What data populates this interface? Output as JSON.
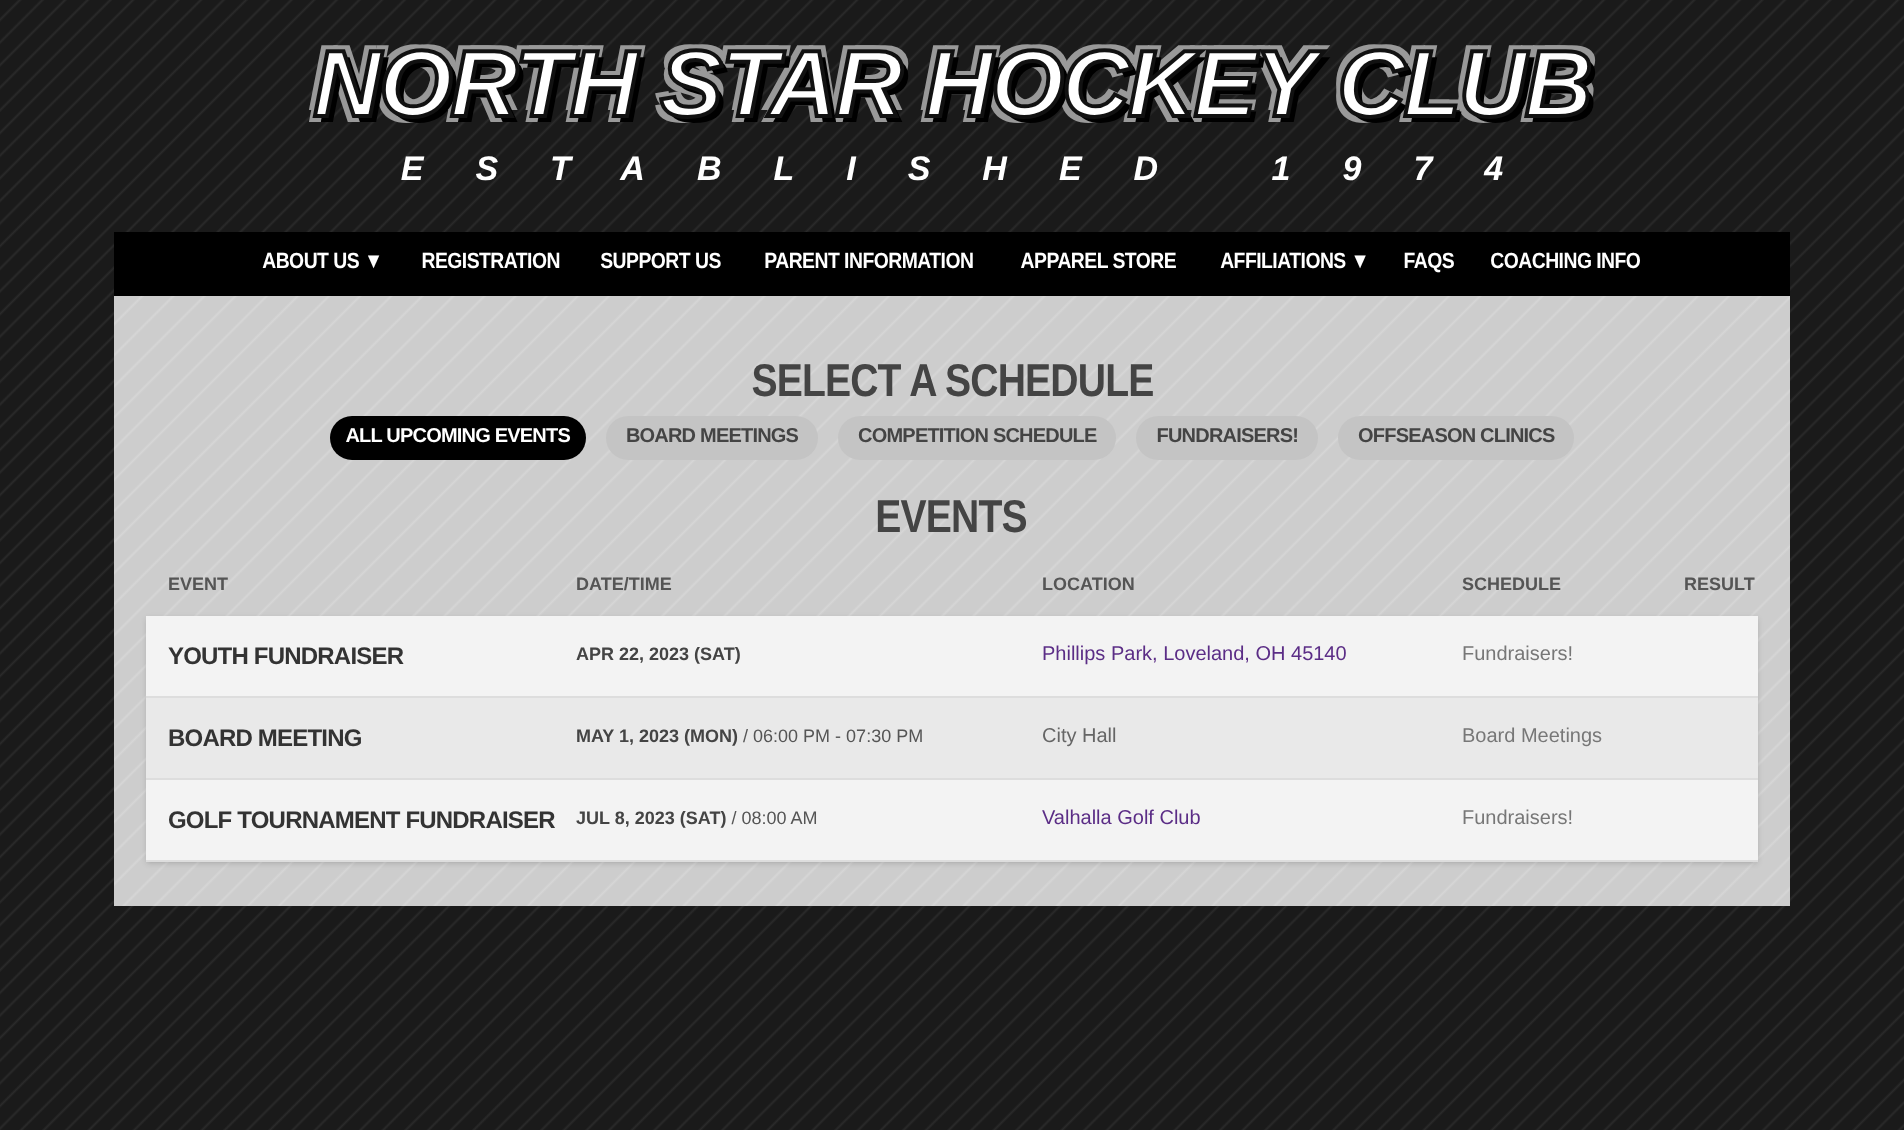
{
  "header": {
    "title": "NORTH STAR HOCKEY CLUB",
    "subtitle": "ESTABLISHED 1974"
  },
  "nav": [
    {
      "label": "ABOUT US",
      "caret": "▼"
    },
    {
      "label": "REGISTRATION"
    },
    {
      "label": "SUPPORT US"
    },
    {
      "label": "PARENT INFORMATION"
    },
    {
      "label": "APPAREL STORE"
    },
    {
      "label": "AFFILIATIONS",
      "caret": "▼"
    },
    {
      "label": "FAQS"
    },
    {
      "label": "COACHING INFO"
    }
  ],
  "schedule_heading": "SELECT A SCHEDULE",
  "filters": [
    {
      "label": "ALL UPCOMING EVENTS",
      "selected": true
    },
    {
      "label": "BOARD MEETINGS",
      "selected": false
    },
    {
      "label": "COMPETITION SCHEDULE",
      "selected": false
    },
    {
      "label": "FUNDRAISERS!",
      "selected": false
    },
    {
      "label": "OFFSEASON CLINICS",
      "selected": false
    }
  ],
  "events_heading": "EVENTS",
  "table": {
    "columns": [
      "EVENT",
      "DATE/TIME",
      "LOCATION",
      "SCHEDULE",
      "RESULT"
    ],
    "rows": [
      {
        "event": "YOUTH FUNDRAISER",
        "date": "APR 22, 2023 (SAT)",
        "location": {
          "kind": "link",
          "text": "Phillips Park, Loveland, OH 45140"
        },
        "schedule": "Fundraisers!"
      },
      {
        "event": "BOARD MEETING",
        "date": "MAY 1, 2023 (MON)",
        "time": "/ 06:00 PM - 07:30 PM",
        "location": {
          "kind": "text",
          "text": "City Hall"
        },
        "schedule": "Board Meetings"
      },
      {
        "event": "GOLF TOURNAMENT FUNDRAISER",
        "date": "JUL 8, 2023 (SAT)",
        "time": "/ 08:00 AM",
        "location": {
          "kind": "link",
          "text": "Valhalla Golf Club"
        },
        "schedule": "Fundraisers!"
      }
    ]
  }
}
